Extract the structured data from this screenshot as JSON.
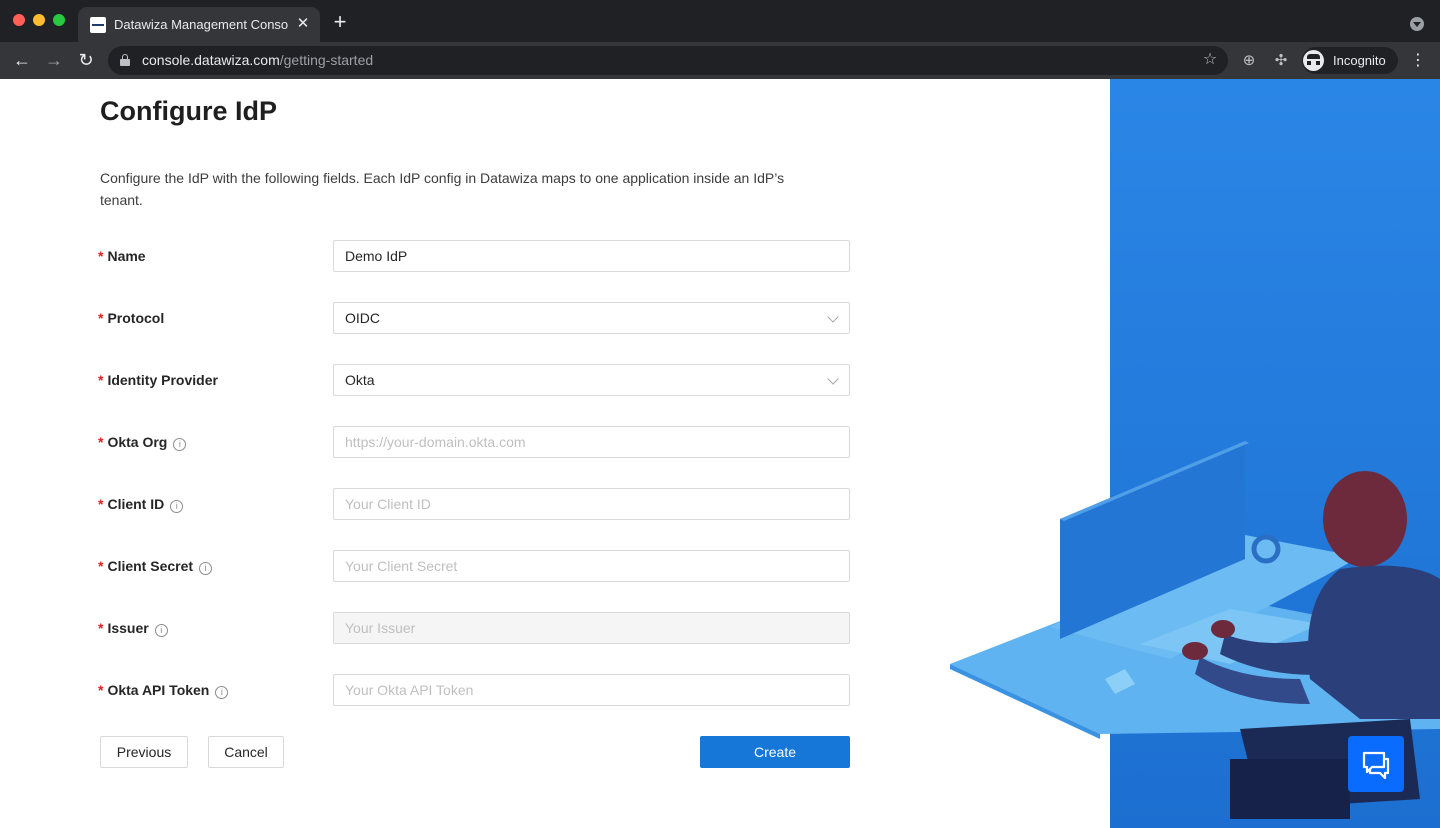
{
  "browser": {
    "tab_title": "Datawiza Management Console",
    "url_domain": "console.datawiza.com",
    "url_path": "/getting-started",
    "profile_label": "Incognito"
  },
  "page": {
    "title": "Configure IdP",
    "description": "Configure the IdP with the following fields. Each IdP config in Datawiza maps to one application inside an IdP’s tenant."
  },
  "form": {
    "required_mark": "*",
    "name": {
      "label": "Name",
      "value": "Demo IdP"
    },
    "protocol": {
      "label": "Protocol",
      "value": "OIDC"
    },
    "identity_provider": {
      "label": "Identity Provider",
      "value": "Okta"
    },
    "okta_org": {
      "label": "Okta Org",
      "placeholder": "https://your-domain.okta.com"
    },
    "client_id": {
      "label": "Client ID",
      "placeholder": "Your Client ID"
    },
    "client_secret": {
      "label": "Client Secret",
      "placeholder": "Your Client Secret"
    },
    "issuer": {
      "label": "Issuer",
      "placeholder": "Your Issuer"
    },
    "okta_api_token": {
      "label": "Okta API Token",
      "placeholder": "Your Okta API Token"
    }
  },
  "actions": {
    "previous": "Previous",
    "cancel": "Cancel",
    "create": "Create"
  },
  "colors": {
    "primary": "#1677d8",
    "required": "#e02020",
    "illustration_blue": "#2680e0",
    "chat_button": "#0a6cff"
  }
}
